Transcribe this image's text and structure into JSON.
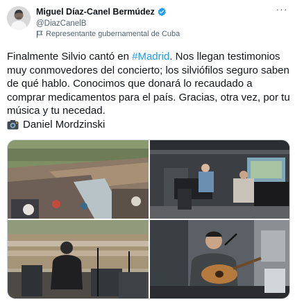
{
  "author": {
    "name": "Miguel Díaz-Canel Bermúdez",
    "handle": "@DiazCanelB",
    "affiliation": "Representante gubernamental de Cuba",
    "verified_icon": "verified-badge-icon",
    "affiliation_icon": "government-flag-icon"
  },
  "menu": {
    "more_icon": "more-options-icon",
    "more_glyph": "···"
  },
  "tweet": {
    "text_before_hashtag": "Finalmente Silvio cantó en ",
    "hashtag": "#Madrid",
    "text_after_hashtag": ". Nos llegan testimonios muy conmovedores del concierto; los silviófilos seguro saben de qué hablo. Conocimos que donará lo recaudado a comprar medicamentos para el país. Gracias, otra vez, por tu música y tu necedad.",
    "photo_credit": "Daniel Mordzinski",
    "credit_icon": "camera-icon"
  },
  "media": {
    "photos": [
      {
        "name": "concert-crowd-photo"
      },
      {
        "name": "stage-piano-photo"
      },
      {
        "name": "guitarist-back-photo"
      },
      {
        "name": "guitarist-closeup-photo"
      }
    ]
  },
  "colors": {
    "accent": "#1d9bf0",
    "secondary_text": "#536471",
    "text": "#0f1419"
  }
}
